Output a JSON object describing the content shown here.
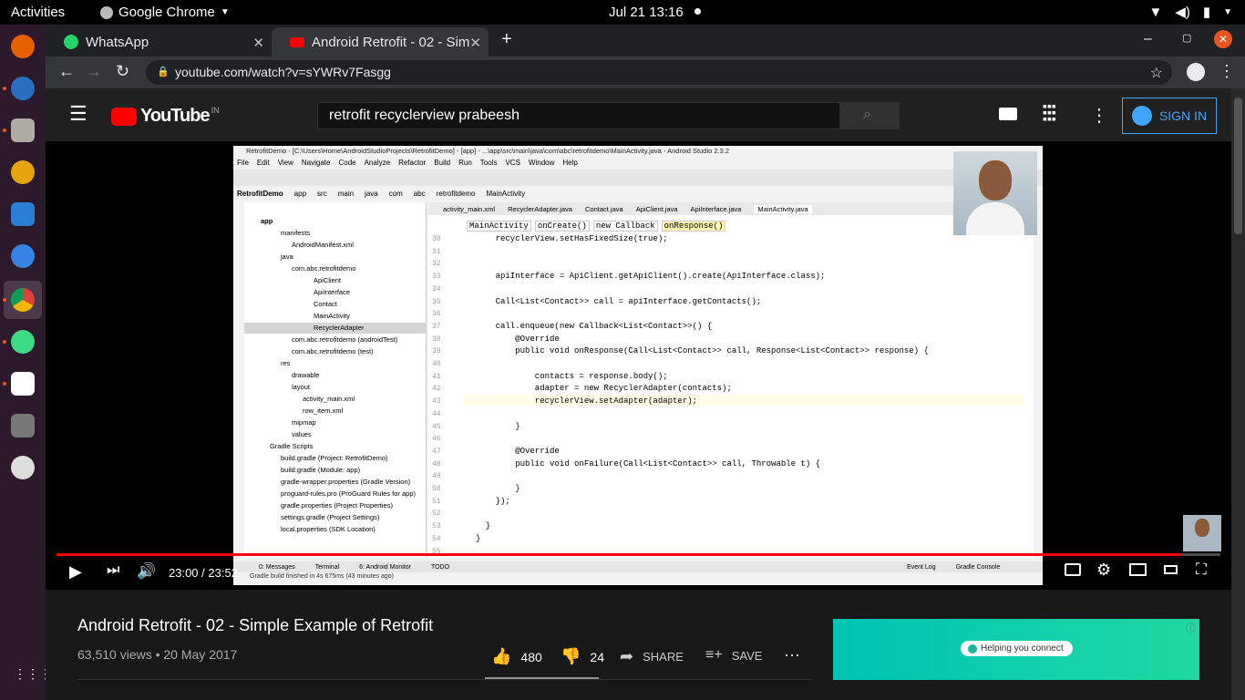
{
  "system": {
    "activities": "Activities",
    "app_name": "Google Chrome",
    "clock": "Jul 21  13:16"
  },
  "tabs": [
    {
      "label": "WhatsApp"
    },
    {
      "label": "Android Retrofit - 02 - Sim"
    }
  ],
  "url": "youtube.com/watch?v=sYWRv7Fasgg",
  "youtube": {
    "logo": "YouTube",
    "region": "IN",
    "search_value": "retrofit recyclerview prabeesh",
    "sign_in": "SIGN IN"
  },
  "player": {
    "time": "23:00 / 23:52",
    "progress": 0.966,
    "ide": {
      "title": "RetrofitDemo - [C:\\Users\\Home\\AndroidStudioProjects\\RetrofitDemo] - [app] - ...\\app\\src\\main\\java\\com\\abc\\retrofitdemo\\MainActivity.java - Android Studio 2.3.2",
      "menu": [
        "File",
        "Edit",
        "View",
        "Navigate",
        "Code",
        "Analyze",
        "Refactor",
        "Build",
        "Run",
        "Tools",
        "VCS",
        "Window",
        "Help"
      ],
      "breadcrumbs": [
        "RetrofitDemo",
        "app",
        "src",
        "main",
        "java",
        "com",
        "abc",
        "retrofitdemo",
        "MainActivity"
      ],
      "editor_tabs": [
        "activity_main.xml",
        "RecyclerAdapter.java",
        "Contact.java",
        "ApiClient.java",
        "ApiInterface.java",
        "MainActivity.java"
      ],
      "crumbs2": [
        "MainActivity",
        "onCreate()",
        "new Callback",
        "onResponse()"
      ],
      "tree": [
        "app",
        "manifests",
        "AndroidManifest.xml",
        "java",
        "com.abc.retrofitdemo",
        "ApiClient",
        "ApiInterface",
        "Contact",
        "MainActivity",
        "RecyclerAdapter",
        "com.abc.retrofitdemo (androidTest)",
        "com.abc.retrofitdemo (test)",
        "res",
        "drawable",
        "layout",
        "activity_main.xml",
        "row_item.xml",
        "mipmap",
        "values",
        "Gradle Scripts",
        "build.gradle (Project: RetrofitDemo)",
        "build.gradle (Module: app)",
        "gradle-wrapper.properties (Gradle Version)",
        "proguard-rules.pro (ProGuard Rules for app)",
        "gradle.properties (Project Properties)",
        "settings.gradle (Project Settings)",
        "local.properties (SDK Location)"
      ],
      "lines": [
        {
          "n": "30",
          "t": "    recyclerView.setHasFixedSize(true);"
        },
        {
          "n": "31",
          "t": ""
        },
        {
          "n": "32",
          "t": ""
        },
        {
          "n": "33",
          "t": "    apiInterface = ApiClient.getApiClient().create(ApiInterface.class);"
        },
        {
          "n": "34",
          "t": ""
        },
        {
          "n": "35",
          "t": "    Call<List<Contact>> call = apiInterface.getContacts();"
        },
        {
          "n": "36",
          "t": ""
        },
        {
          "n": "37",
          "t": "    call.enqueue(new Callback<List<Contact>>() {"
        },
        {
          "n": "38",
          "t": "        @Override"
        },
        {
          "n": "39",
          "t": "        public void onResponse(Call<List<Contact>> call, Response<List<Contact>> response) {"
        },
        {
          "n": "40",
          "t": ""
        },
        {
          "n": "41",
          "t": "            contacts = response.body();"
        },
        {
          "n": "42",
          "t": "            adapter = new RecyclerAdapter(contacts);"
        },
        {
          "n": "43",
          "t": "            recyclerView.setAdapter(adapter);"
        },
        {
          "n": "44",
          "t": ""
        },
        {
          "n": "45",
          "t": "        }"
        },
        {
          "n": "46",
          "t": ""
        },
        {
          "n": "47",
          "t": "        @Override"
        },
        {
          "n": "48",
          "t": "        public void onFailure(Call<List<Contact>> call, Throwable t) {"
        },
        {
          "n": "49",
          "t": ""
        },
        {
          "n": "50",
          "t": "        }"
        },
        {
          "n": "51",
          "t": "    });"
        },
        {
          "n": "52",
          "t": ""
        },
        {
          "n": "53",
          "t": "  }"
        },
        {
          "n": "54",
          "t": "}"
        },
        {
          "n": "55",
          "t": ""
        }
      ],
      "bottom_tabs": [
        "0: Messages",
        "Terminal",
        "6: Android Monitor",
        "TODO",
        "Event Log",
        "Gradle Console"
      ],
      "status": "Gradle build finished in 4s 675ms (43 minutes ago)"
    }
  },
  "video": {
    "title": "Android Retrofit - 02 - Simple Example of Retrofit",
    "meta": "63,510 views • 20 May 2017",
    "likes": "480",
    "dislikes": "24",
    "share": "SHARE",
    "save": "SAVE",
    "ad_text": "Helping you connect"
  },
  "colors": {
    "yt_red": "#ff0000",
    "accent_blue": "#3ea6ff",
    "bg": "#181818"
  }
}
